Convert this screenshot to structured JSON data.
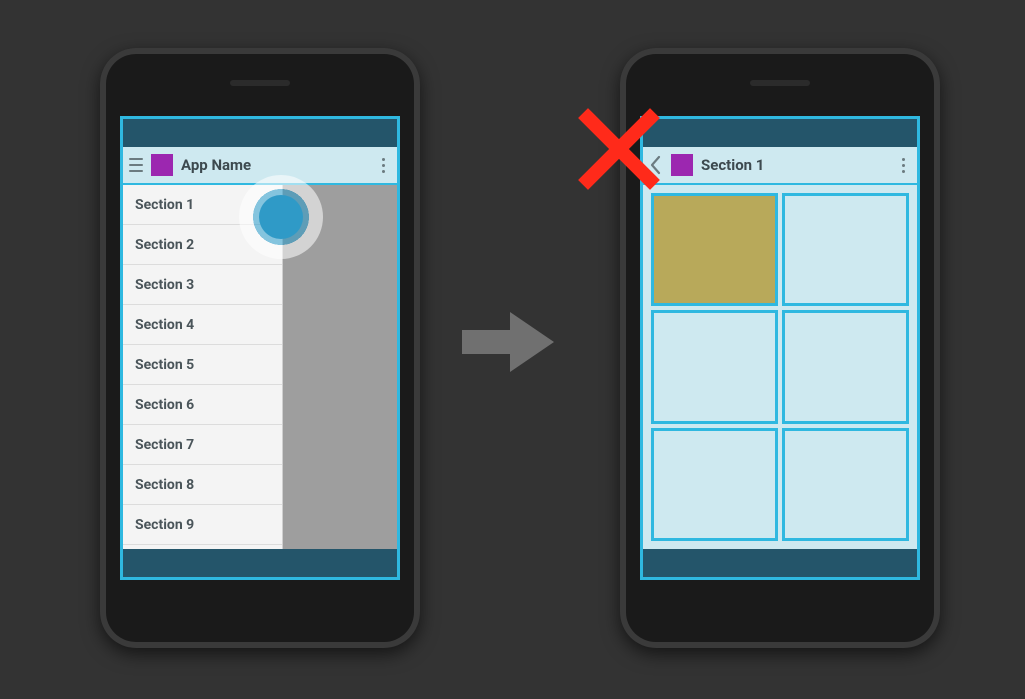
{
  "left": {
    "title": "App Name",
    "drawer_items": [
      "Section 1",
      "Section 2",
      "Section 3",
      "Section 4",
      "Section 5",
      "Section 6",
      "Section 7",
      "Section 8",
      "Section 9"
    ]
  },
  "right": {
    "title": "Section 1",
    "grid_selected_index": 0
  },
  "colors": {
    "accent": "#2fb8e0",
    "brand": "#9c27b0",
    "error": "#ff2a1a"
  }
}
